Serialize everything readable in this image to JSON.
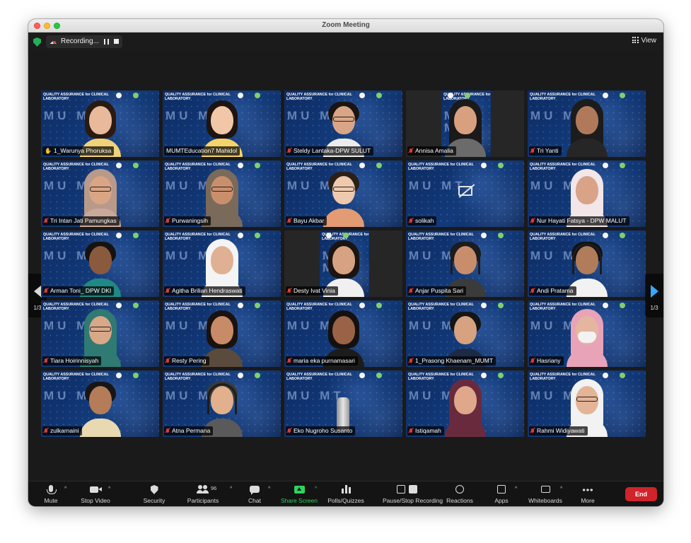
{
  "window": {
    "title": "Zoom Meeting"
  },
  "topbar": {
    "recording_label": "Recording...",
    "view_label": "View"
  },
  "slide": {
    "title": "QUALITY ASSURANCE for CLINICAL LABORATORY",
    "brand": "MU MT"
  },
  "pagination": {
    "left": "1/3",
    "right": "1/3"
  },
  "participants": [
    {
      "name": "1_Warunya Phoruksa",
      "active": true,
      "hand": true,
      "muted": false,
      "avatar": {
        "kind": "hair",
        "skin": "#e8b99a",
        "hair": "#2a1a12",
        "shirt": "#f0d27a"
      }
    },
    {
      "name": "MUMTEducation7 Mahidol",
      "active": false,
      "hand": false,
      "muted": false,
      "avatar": {
        "kind": "hair",
        "skin": "#f1c7a8",
        "hair": "#1e1410",
        "shirt": "#f4d36b"
      }
    },
    {
      "name": "Steldy Lantaka-DPW SULUT",
      "active": false,
      "hand": false,
      "muted": true,
      "avatar": {
        "kind": "glasses",
        "skin": "#d9a587",
        "hair": "#1b1410",
        "shirt": "#ececec"
      }
    },
    {
      "name": "Annisa Amalia",
      "active": false,
      "hand": false,
      "muted": true,
      "dark": true,
      "avatar": {
        "kind": "hijab",
        "skin": "#d8a07f",
        "hair": "#1a1a1a",
        "shirt": "#6b6b6b"
      }
    },
    {
      "name": "Tri Yanti",
      "active": false,
      "hand": false,
      "muted": true,
      "avatar": {
        "kind": "hijab",
        "skin": "#b07a5a",
        "hair": "#1c1c1c",
        "shirt": "#262626"
      }
    },
    {
      "name": "Tri Intan Jati Pamungkas",
      "active": false,
      "hand": false,
      "muted": true,
      "avatar": {
        "kind": "hijab-glasses",
        "skin": "#d9a585",
        "hair": "#b99a8a",
        "shirt": "#c9a99a"
      }
    },
    {
      "name": "Purwaningsih",
      "active": false,
      "hand": false,
      "muted": true,
      "avatar": {
        "kind": "hijab-glasses",
        "skin": "#c98f6c",
        "hair": "#7a6a5a",
        "shirt": "#7a6a5a"
      }
    },
    {
      "name": "Bayu Akbar",
      "active": false,
      "hand": false,
      "muted": true,
      "avatar": {
        "kind": "glasses",
        "skin": "#efc9ad",
        "hair": "#2b2018",
        "shirt": "#e39b74"
      }
    },
    {
      "name": "solikah",
      "active": false,
      "hand": false,
      "muted": true,
      "camoff": true,
      "avatar": {
        "kind": "none",
        "skin": "",
        "hair": "",
        "shirt": ""
      }
    },
    {
      "name": "Nur Hayati Fatsya - DPW MALUT",
      "active": false,
      "hand": false,
      "muted": true,
      "avatar": {
        "kind": "hijab",
        "skin": "#d8a387",
        "hair": "#f2e6e8",
        "shirt": "#f2e6e8"
      }
    },
    {
      "name": "Arman Toni_ DPW DKI",
      "active": false,
      "hand": false,
      "muted": true,
      "avatar": {
        "kind": "plain",
        "skin": "#8a5a3e",
        "hair": "#161210",
        "shirt": "#1f8a84"
      }
    },
    {
      "name": "Agitha Brilian Hendraswati",
      "active": false,
      "hand": false,
      "muted": true,
      "avatar": {
        "kind": "hijab",
        "skin": "#e0b095",
        "hair": "#f4f4f4",
        "shirt": "#f4f4f4"
      }
    },
    {
      "name": "Desty Ivat Vinia",
      "active": false,
      "hand": false,
      "muted": true,
      "dark": true,
      "avatar": {
        "kind": "hair",
        "skin": "#d7a283",
        "hair": "#1b1410",
        "shirt": "#f0f0f0"
      }
    },
    {
      "name": "Anjar Puspita Sari",
      "active": false,
      "hand": false,
      "muted": true,
      "avatar": {
        "kind": "headset",
        "skin": "#c88e6c",
        "hair": "#1c1c1c",
        "shirt": "#3b3b3b"
      }
    },
    {
      "name": "Andi Pratama",
      "active": false,
      "hand": false,
      "muted": true,
      "avatar": {
        "kind": "headset",
        "skin": "#b07c5a",
        "hair": "#121212",
        "shirt": "#f2f2f2"
      }
    },
    {
      "name": "Tiara Hoirinnisyah",
      "active": false,
      "hand": false,
      "muted": true,
      "avatar": {
        "kind": "hijab-glasses",
        "skin": "#d9a888",
        "hair": "#2f7a72",
        "shirt": "#2f7a72"
      }
    },
    {
      "name": "Resty Pering",
      "active": false,
      "hand": false,
      "muted": true,
      "avatar": {
        "kind": "hair",
        "skin": "#c78b68",
        "hair": "#1a120e",
        "shirt": "#5b4b3c"
      }
    },
    {
      "name": "maria eka purnamasari",
      "active": false,
      "hand": false,
      "muted": true,
      "avatar": {
        "kind": "hair",
        "skin": "#9a6246",
        "hair": "#151010",
        "shirt": "#1c1c1c"
      }
    },
    {
      "name": "1_Prasong Khaenam_MUMT",
      "active": false,
      "hand": false,
      "muted": true,
      "avatar": {
        "kind": "plain",
        "skin": "#d6a27f",
        "hair": "#151515",
        "shirt": "#1c2a44"
      }
    },
    {
      "name": "Hasriany",
      "active": false,
      "hand": false,
      "muted": true,
      "avatar": {
        "kind": "hijab-mask",
        "skin": "#e4b6a0",
        "hair": "#e8a3b8",
        "shirt": "#e8a3b8"
      }
    },
    {
      "name": "zulkarnaini",
      "active": false,
      "hand": false,
      "muted": true,
      "avatar": {
        "kind": "plain",
        "skin": "#b47c58",
        "hair": "#161616",
        "shirt": "#e9d9b0"
      }
    },
    {
      "name": "Atna Permana",
      "active": false,
      "hand": false,
      "muted": true,
      "avatar": {
        "kind": "headset",
        "skin": "#e2b08c",
        "hair": "#3a3a3a",
        "shirt": "#5a5a5a"
      }
    },
    {
      "name": "Eko Nugroho Susanto",
      "active": false,
      "hand": false,
      "muted": true,
      "avatar": {
        "kind": "bottle",
        "skin": "#c8c8c8",
        "hair": "#9a9a9a",
        "shirt": "#9a9a9a"
      }
    },
    {
      "name": "Istiqamah",
      "active": false,
      "hand": false,
      "muted": true,
      "avatar": {
        "kind": "hijab",
        "skin": "#e0a88a",
        "hair": "#6a2a3e",
        "shirt": "#6a2a3e"
      }
    },
    {
      "name": "Rahmi Widiyawati",
      "active": false,
      "hand": false,
      "muted": true,
      "avatar": {
        "kind": "hijab-glasses",
        "skin": "#e3b496",
        "hair": "#f2f2f2",
        "shirt": "#f2f2f2"
      }
    }
  ],
  "toolbar": {
    "mute": "Mute",
    "video": "Stop Video",
    "security": "Security",
    "participants": "Participants",
    "participant_count": "96",
    "chat": "Chat",
    "share": "Share Screen",
    "polls": "Polls/Quizzes",
    "record": "Pause/Stop Recording",
    "reactions": "Reactions",
    "apps": "Apps",
    "whiteboards": "Whiteboards",
    "more": "More",
    "end": "End"
  },
  "colors": {
    "accent_green": "#2bd45d",
    "end_red": "#d0232a",
    "arrow_blue": "#38a7ff"
  }
}
